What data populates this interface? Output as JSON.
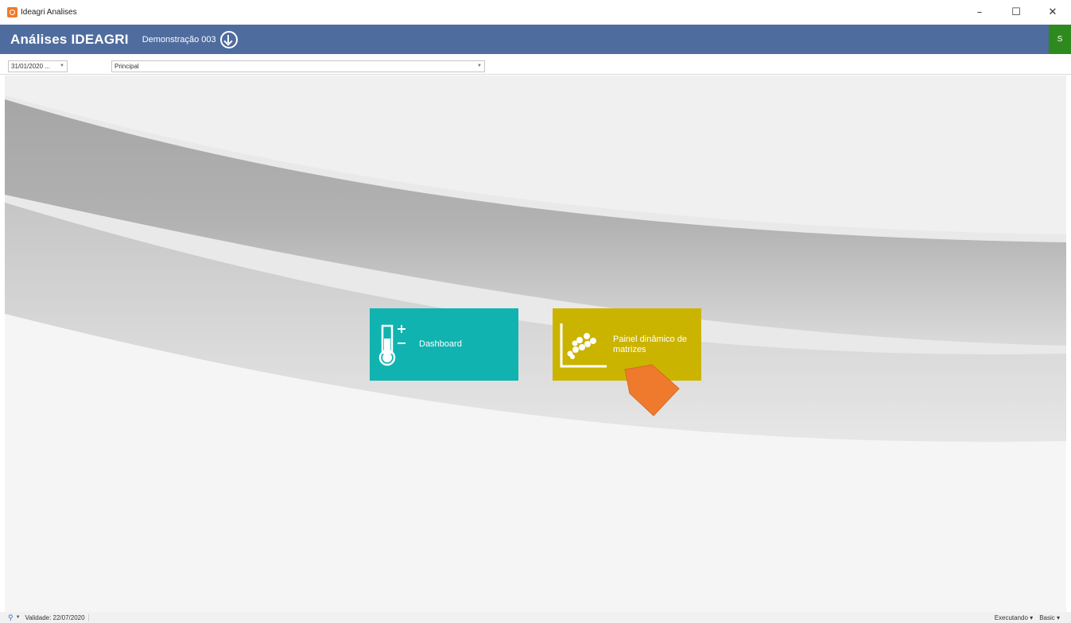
{
  "window": {
    "title": "Ideagri Analises",
    "minimize": "–",
    "maximize": "☐",
    "close": "✕"
  },
  "header": {
    "app_name": "Análises IDEAGRI",
    "database": "Demonstração 003",
    "user_initial": "S"
  },
  "filters": {
    "date_value": "31/01/2020 ...",
    "panel_value": "Principal"
  },
  "tiles": [
    {
      "label": "Dashboard",
      "icon": "thermometer-plus-minus-icon",
      "color": "#10b3b0"
    },
    {
      "label": "Painel dinâmico de matrizes",
      "icon": "scatter-plot-icon",
      "color": "#cbb400"
    }
  ],
  "status": {
    "validity": "Validade: 22/07/2020",
    "state": "Executando ▾",
    "mode": "Basic ▾"
  },
  "colors": {
    "header": "#4f6c9e",
    "user_badge": "#2e8a1e",
    "cursor": "#ef7a2e"
  }
}
